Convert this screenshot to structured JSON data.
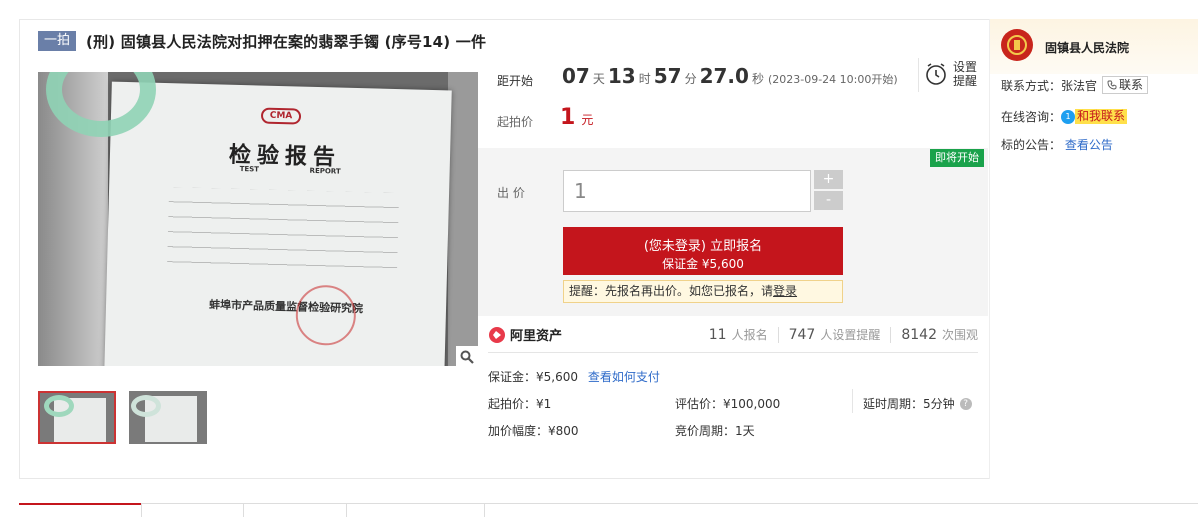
{
  "title": {
    "tag": "一拍",
    "text": "(刑) 固镇县人民法院对扣押在案的翡翠手镯 (序号14) 一件"
  },
  "image": {
    "logo": "CMA",
    "doc_title": "检验报告",
    "doc_sub_left": "TEST",
    "doc_sub_right": "REPORT",
    "doc_org": "蚌埠市产品质量监督检验研究院"
  },
  "countdown": {
    "label": "距开始",
    "days": "07",
    "days_unit": "天",
    "hours": "13",
    "hours_unit": "时",
    "minutes": "57",
    "minutes_unit": "分",
    "seconds": "27.0",
    "seconds_unit": "秒",
    "start_note": "(2023-09-24 10:00开始)",
    "remind_line1": "设置",
    "remind_line2": "提醒"
  },
  "start_price": {
    "label": "起拍价",
    "value": "1",
    "unit": "元"
  },
  "bid": {
    "status_badge": "即将开始",
    "label": "出 价",
    "input_placeholder": "1",
    "plus": "+",
    "minus": "-",
    "signup_line1": "(您未登录) 立即报名",
    "signup_line2": "保证金 ¥5,600",
    "tip_prefix": "提醒：先报名再出价。如您已报名，请",
    "tip_link": "登录"
  },
  "stats": {
    "brand": "阿里资产",
    "signups": "11",
    "signups_label": "人报名",
    "reminders": "747",
    "reminders_label": "人设置提醒",
    "views": "8142",
    "views_label": "次围观"
  },
  "details": {
    "deposit": "保证金：¥5,600",
    "deposit_link": "查看如何支付",
    "start_price": "起拍价：¥1",
    "appraisal": "评估价：¥100,000",
    "delay": "延时周期：5分钟",
    "increment": "加价幅度：¥800",
    "bid_period": "竞价周期：1天"
  },
  "court": {
    "name": "固镇县人民法院",
    "contact_label": "联系方式：",
    "contact_name": "张法官",
    "contact_button": "联系",
    "consult_label": "在线咨询：",
    "consult_button": "和我联系",
    "notice_label": "标的公告：",
    "notice_link": "查看公告"
  },
  "colors": {
    "accent_red": "#c4151c",
    "link_blue": "#2f6bc9",
    "green_badge": "#1aa24b",
    "tag_blue": "#6a7fa8"
  }
}
